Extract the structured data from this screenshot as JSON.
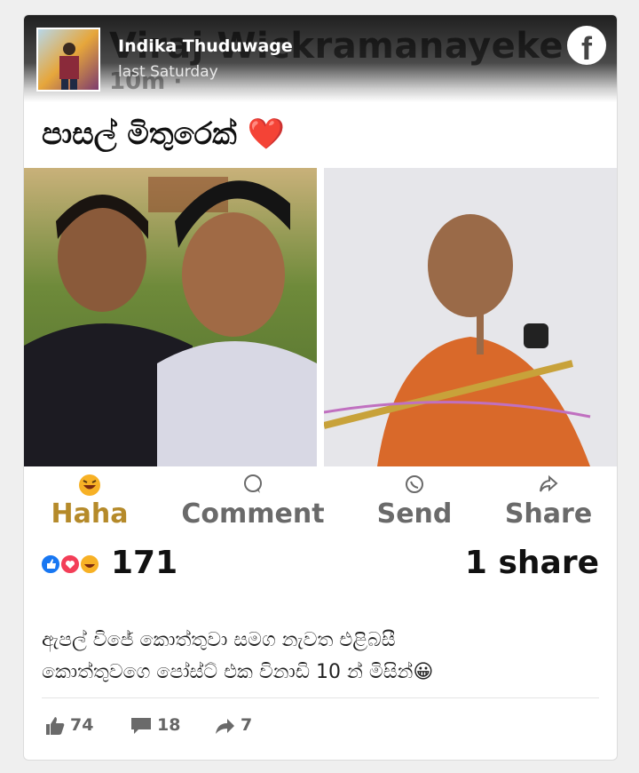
{
  "post": {
    "author": "Indika Thuduwage",
    "time": "last Saturday",
    "header_overlay_name": "Viraj Wickramanayeke",
    "header_overlay_time": "10m ·",
    "title": "පාසල් මිතුරෙක් ❤️",
    "actions": {
      "haha": "Haha",
      "comment": "Comment",
      "send": "Send",
      "share": "Share"
    },
    "reaction_count": "171",
    "share_count": "1 share",
    "caption_line1": "ඇපල් විජේ කොත්තුවා සමග නැවත එළිබසී",
    "caption_line2": "කොත්තුවගෙ පෝස්ට් එක විනාඩි 10 න් මිසින්😀",
    "footer": {
      "likes": "74",
      "comments": "18",
      "shares": "7"
    }
  },
  "icons": {
    "brand": "facebook-icon",
    "haha_color": "#f7b125",
    "like_color": "#1877f2",
    "love_color": "#f33e58"
  }
}
